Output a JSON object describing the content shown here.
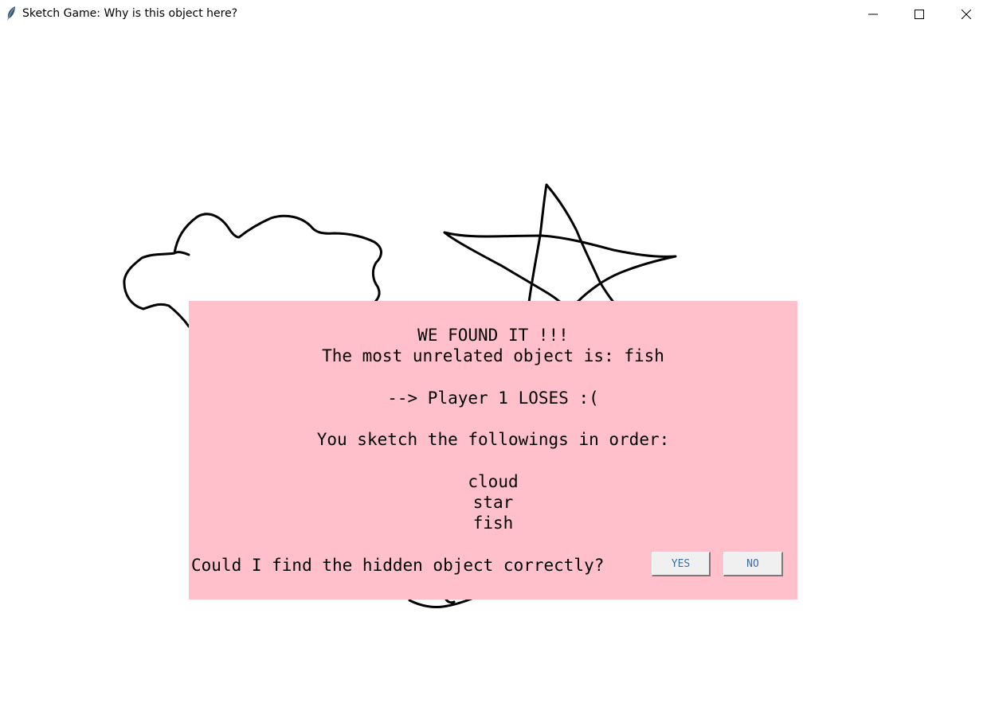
{
  "window": {
    "title": "Sketch Game: Why is this object here?",
    "icon": "feather-icon",
    "controls": [
      "minimize-icon",
      "maximize-icon",
      "close-icon"
    ]
  },
  "sketches": [
    "cloud",
    "star",
    "fish"
  ],
  "dialog": {
    "background": "#ffc0cb",
    "headline": "WE FOUND IT !!!",
    "result": "The most unrelated object is: fish",
    "outcome": "--> Player 1 LOSES :(",
    "order_intro": "You sketch the followings in order:",
    "order_items": [
      "cloud",
      "star",
      "fish"
    ],
    "question": "Could I find the hidden object correctly?",
    "yes_label": "YES",
    "no_label": "NO"
  }
}
